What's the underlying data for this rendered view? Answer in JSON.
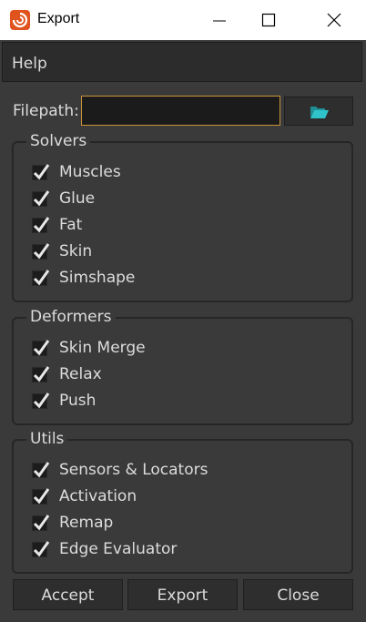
{
  "window": {
    "title": "Export",
    "icon": "houdini-logo-icon"
  },
  "menubar": {
    "items": [
      {
        "label": "Help"
      }
    ]
  },
  "filepath": {
    "label": "Filepath:",
    "value": "",
    "browse_icon": "folder-open-icon"
  },
  "groups": [
    {
      "title": "Solvers",
      "items": [
        {
          "label": "Muscles",
          "checked": true
        },
        {
          "label": "Glue",
          "checked": true
        },
        {
          "label": "Fat",
          "checked": true
        },
        {
          "label": "Skin",
          "checked": true
        },
        {
          "label": "Simshape",
          "checked": true
        }
      ]
    },
    {
      "title": "Deformers",
      "items": [
        {
          "label": "Skin Merge",
          "checked": true
        },
        {
          "label": "Relax",
          "checked": true
        },
        {
          "label": "Push",
          "checked": true
        }
      ]
    },
    {
      "title": "Utils",
      "items": [
        {
          "label": "Sensors & Locators",
          "checked": true
        },
        {
          "label": "Activation",
          "checked": true
        },
        {
          "label": "Remap",
          "checked": true
        },
        {
          "label": "Edge Evaluator",
          "checked": true
        }
      ]
    }
  ],
  "buttons": {
    "accept": "Accept",
    "export": "Export",
    "close": "Close"
  },
  "colors": {
    "accent_border": "#c8943a",
    "folder_icon": "#2ec4c9",
    "app_icon": "#e0531d"
  }
}
